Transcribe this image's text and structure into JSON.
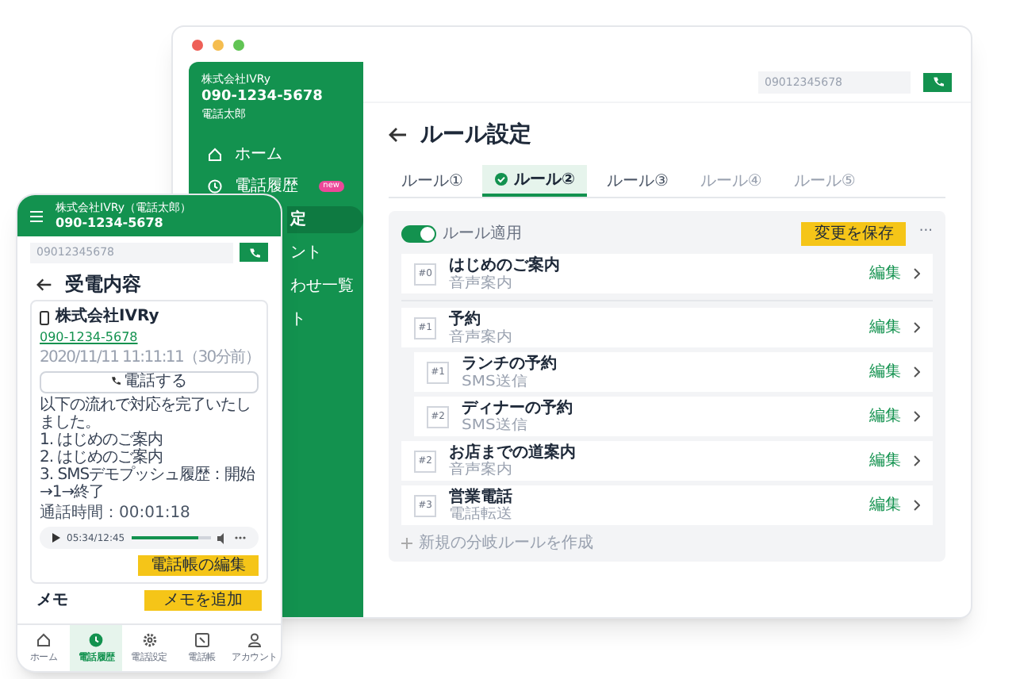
{
  "desktop": {
    "sidebar": {
      "company": "株式会社IVRy",
      "phone": "090-1234-5678",
      "user": "電話太郎",
      "items": [
        {
          "kind": "full",
          "label": "ホーム",
          "selected": false
        },
        {
          "kind": "full",
          "label": "電話履歴",
          "selected": false,
          "badge": "new"
        },
        {
          "kind": "partial",
          "label": "定",
          "selected": true
        },
        {
          "kind": "partial",
          "label": "ント",
          "selected": false
        },
        {
          "kind": "partial",
          "label": "わせ一覧",
          "selected": false
        },
        {
          "kind": "partial",
          "label": "ト",
          "selected": false
        }
      ]
    },
    "search": {
      "value": "09012345678"
    },
    "title": "ルール設定",
    "tabs": [
      {
        "label": "ルール①",
        "selected": false,
        "disabled": false
      },
      {
        "label": "ルール②",
        "selected": true,
        "disabled": false
      },
      {
        "label": "ルール③",
        "selected": false,
        "disabled": false
      },
      {
        "label": "ルール④",
        "selected": false,
        "disabled": true
      },
      {
        "label": "ルール⑤",
        "selected": false,
        "disabled": true
      }
    ],
    "rule_toggle": {
      "label": "ルール適用",
      "on": true
    },
    "save_button": "変更を保存",
    "more": "···",
    "rules": [
      {
        "number": "#0",
        "title": "はじめのご案内",
        "type": "音声案内",
        "action": "編集"
      },
      {
        "number": "#1",
        "title": "予約",
        "type": "音声案内",
        "action": "編集",
        "children": [
          {
            "number": "#1",
            "title": "ランチの予約",
            "type": "SMS送信",
            "action": "編集"
          },
          {
            "number": "#2",
            "title": "ディナーの予約",
            "type": "SMS送信",
            "action": "編集"
          }
        ]
      },
      {
        "number": "#2",
        "title": "お店までの道案内",
        "type": "音声案内",
        "action": "編集"
      },
      {
        "number": "#3",
        "title": "営業電話",
        "type": "電話転送",
        "action": "編集"
      }
    ],
    "add_rule": "新規の分岐ルールを作成"
  },
  "phone": {
    "header": {
      "title": "株式会社IVRy（電話太郎）",
      "phone": "090-1234-5678"
    },
    "search": {
      "value": "09012345678"
    },
    "title": "受電内容",
    "card": {
      "company": "株式会社IVRy",
      "phone_link": "090-1234-5678",
      "datetime": "2020/11/11 11:11:11（30分前）",
      "call_button": "電話する",
      "lines": [
        "以下の流れで対応を完了いたしました。",
        "1. はじめのご案内",
        "2. はじめのご案内",
        "3. SMSデモプッシュ履歴：開始→1→終了"
      ],
      "duration": "通話時間：00:01:18",
      "player": {
        "time": "05:34/12:45",
        "level": 0.85
      },
      "edit_button": "電話帳の編集"
    },
    "memo": {
      "label": "メモ",
      "add_button": "メモを追加"
    },
    "nav": [
      {
        "label": "ホーム",
        "selected": false
      },
      {
        "label": "電話履歴",
        "selected": true
      },
      {
        "label": "電話設定",
        "selected": false
      },
      {
        "label": "電話帳",
        "selected": false
      },
      {
        "label": "アカウント",
        "selected": false
      }
    ]
  }
}
